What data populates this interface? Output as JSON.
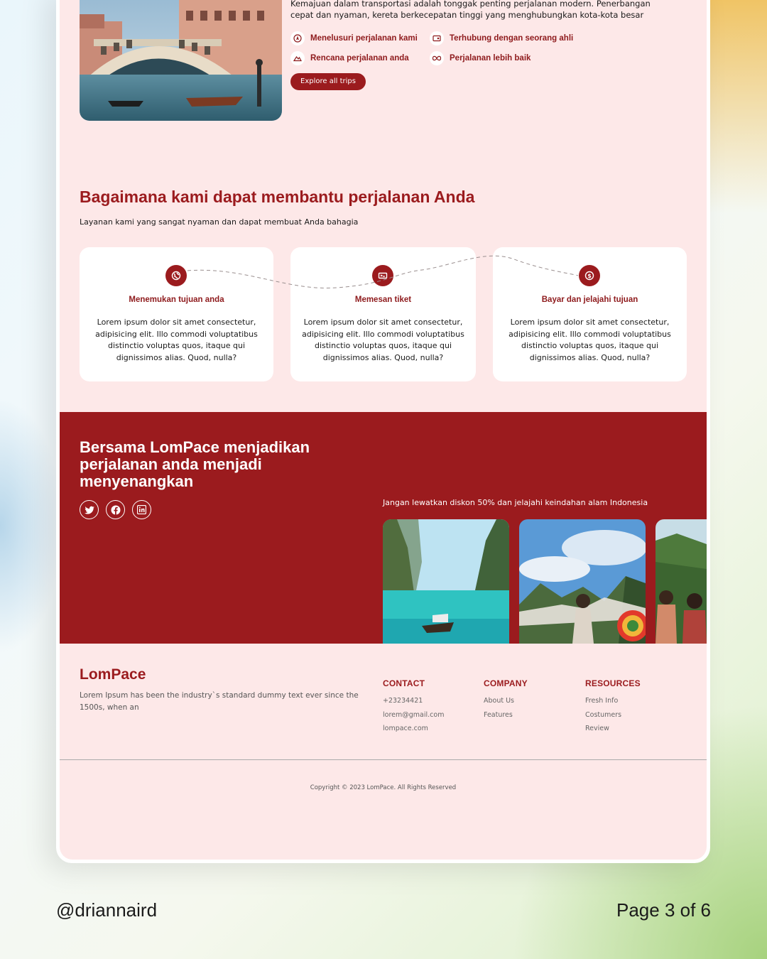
{
  "intro": {
    "text": "Kemajuan dalam transportasi adalah tonggak penting perjalanan modern. Penerbangan cepat dan nyaman, kereta berkecepatan tinggi yang menghubungkan kota-kota besar",
    "features": [
      {
        "label": "Menelusuri perjalanan kami",
        "icon": "compass-icon"
      },
      {
        "label": "Terhubung dengan seorang ahli",
        "icon": "id-card-icon"
      },
      {
        "label": "Rencana perjalanan anda",
        "icon": "mountain-icon"
      },
      {
        "label": "Perjalanan lebih baik",
        "icon": "infinity-icon"
      }
    ],
    "button": "Explore all trips"
  },
  "help": {
    "title": "Bagaimana kami dapat membantu perjalanan Anda",
    "subtitle": "Layanan kami yang sangat nyaman dan dapat membuat Anda bahagia",
    "cards": [
      {
        "title": "Menemukan tujuan anda",
        "icon": "globe-icon",
        "body": "Lorem ipsum dolor sit amet consectetur, adipisicing elit. Illo commodi voluptatibus distinctio voluptas quos, itaque qui dignissimos alias. Quod, nulla?"
      },
      {
        "title": "Memesan tiket",
        "icon": "ticket-icon",
        "body": "Lorem ipsum dolor sit amet consectetur, adipisicing elit. Illo commodi voluptatibus distinctio voluptas quos, itaque qui dignissimos alias. Quod, nulla?"
      },
      {
        "title": "Bayar dan jelajahi tujuan",
        "icon": "dollar-icon",
        "body": "Lorem ipsum dolor sit amet consectetur, adipisicing elit. Illo commodi voluptatibus distinctio voluptas quos, itaque qui dignissimos alias. Quod, nulla?"
      }
    ]
  },
  "band": {
    "title": "Bersama LomPace menjadikan perjalanan anda menjadi menyenangkan",
    "socials": [
      "twitter-icon",
      "facebook-icon",
      "linkedin-icon"
    ],
    "promo": "Jangan lewatkan diskon 50% dan jelajahi keindahan alam Indonesia"
  },
  "footer": {
    "brand": "LomPace",
    "description": "Lorem Ipsum has been the industry`s standard dummy text ever since the 1500s, when an",
    "columns": [
      {
        "heading": "CONTACT",
        "items": [
          "+23234421",
          "lorem@gmail.com",
          "lompace.com"
        ]
      },
      {
        "heading": "COMPANY",
        "items": [
          "About Us",
          "Features"
        ]
      },
      {
        "heading": "RESOURCES",
        "items": [
          "Fresh Info",
          "Costumers",
          "Review"
        ]
      }
    ],
    "copyright": "Copyright © 2023 LomPace. All Rights Reserved"
  },
  "caption": {
    "handle": "@driannaird",
    "page": "Page 3 of 6"
  },
  "colors": {
    "accent": "#9b1b1e",
    "page_bg": "#fde8e8",
    "card_bg": "#ffffff"
  }
}
